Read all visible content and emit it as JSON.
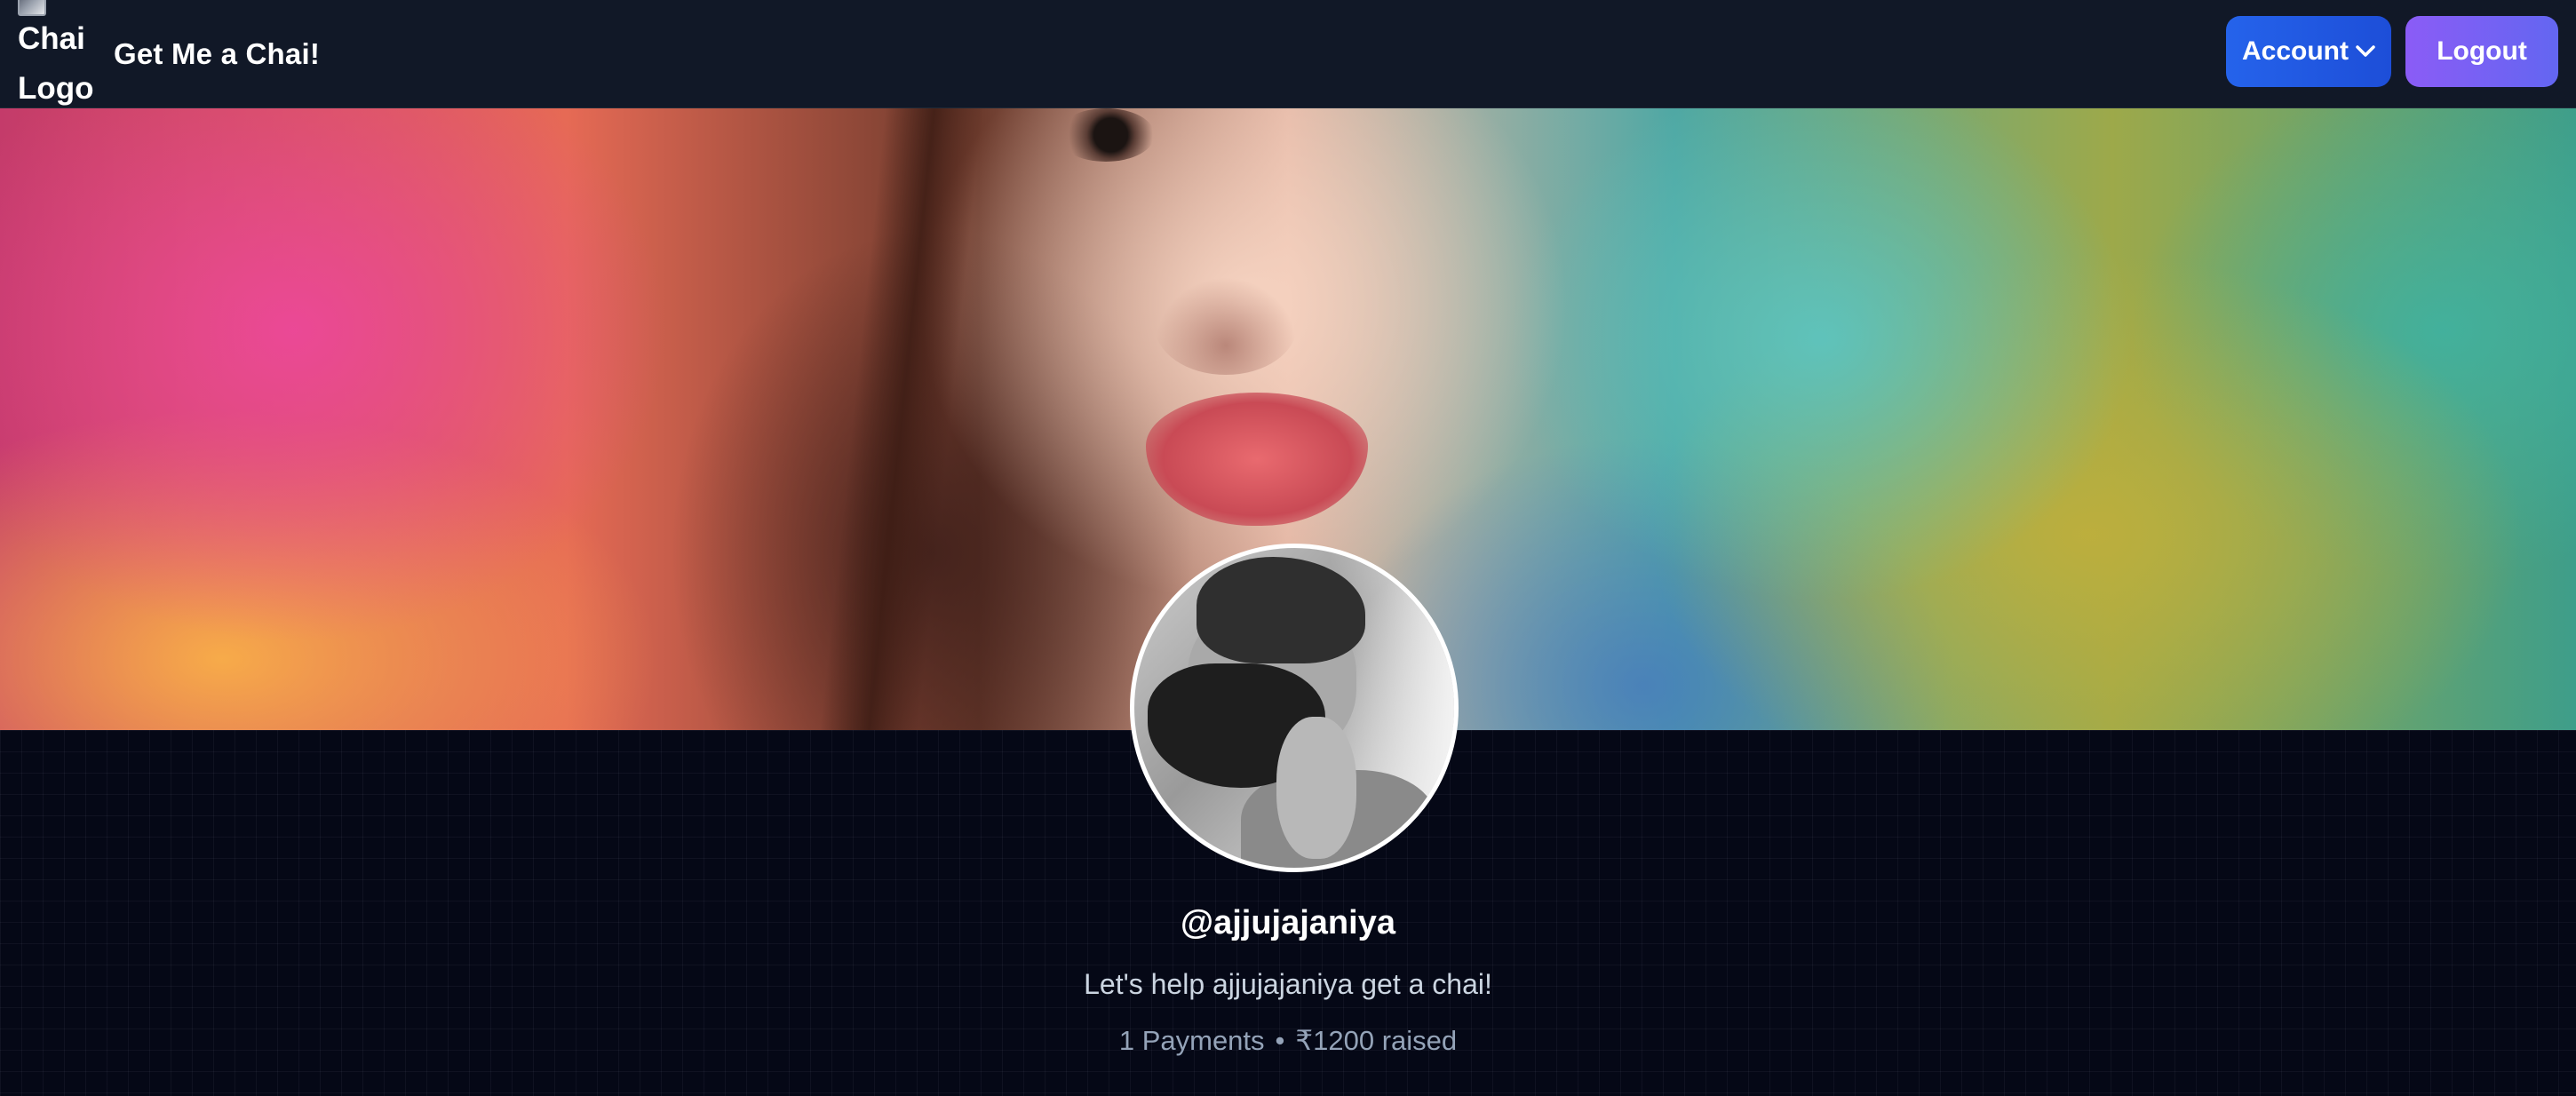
{
  "navbar": {
    "logo_alt": "Chai Logo",
    "brand_title": "Get Me a Chai!",
    "account_label": "Account",
    "account_icon": "chevron-down-icon",
    "logout_label": "Logout"
  },
  "profile": {
    "username": "@ajjujajaniya",
    "tagline": "Let's help ajjujajaniya get a chai!",
    "payments_text": "1 Payments",
    "separator": "•",
    "raised_text": "₹1200 raised"
  },
  "colors": {
    "navbar_bg": "#111827",
    "page_bg": "#050816",
    "account_button": "#2563eb",
    "logout_button": "#8b5cf6"
  }
}
